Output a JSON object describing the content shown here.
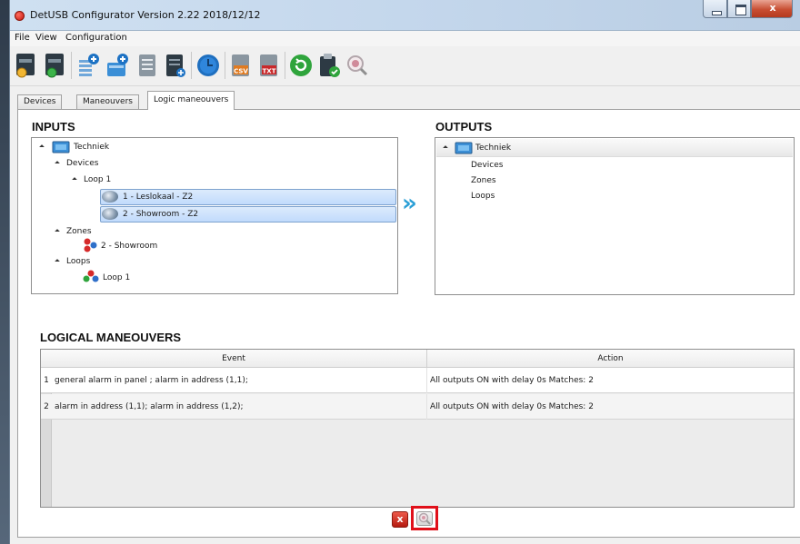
{
  "window": {
    "title": "DetUSB Configurator Version 2.22 2018/12/12",
    "close_glyph": "x"
  },
  "menu": {
    "items": [
      "File",
      "View",
      "Configuration"
    ]
  },
  "toolbar": {
    "icons": [
      "open-config-icon",
      "save-config-icon",
      "add-device-list-icon",
      "add-device-upload-icon",
      "document-icon",
      "document-add-icon",
      "clock-icon",
      "export-csv-icon",
      "export-txt-icon",
      "refresh-icon",
      "clipboard-check-icon",
      "search-icon"
    ],
    "csv_label": "CSV",
    "txt_label": "TXT"
  },
  "tabs": {
    "items": [
      "Devices",
      "Maneouvers",
      "Logic maneouvers"
    ],
    "active": "Logic maneouvers"
  },
  "inputs": {
    "heading": "INPUTS",
    "root": "Techniek",
    "devices": "Devices",
    "loop1": "Loop 1",
    "device1": "1 - Leslokaal - Z2",
    "device2": "2 - Showroom - Z2",
    "zones": "Zones",
    "zone2": "2 - Showroom",
    "loops": "Loops",
    "loop_item": "Loop 1"
  },
  "transfer": {
    "glyph": "»"
  },
  "outputs": {
    "heading": "OUTPUTS",
    "root": "Techniek",
    "devices": "Devices",
    "zones": "Zones",
    "loops": "Loops"
  },
  "logical": {
    "heading": "LOGICAL MANEOUVERS",
    "columns": {
      "event": "Event",
      "action": "Action"
    },
    "rows": [
      {
        "num": "1",
        "event": "general alarm in panel ; alarm  in address (1,1);",
        "action": "All outputs ON with delay 0s Matches: 2"
      },
      {
        "num": "2",
        "event": "alarm  in address (1,1); alarm  in address (1,2);",
        "action": "All outputs ON with delay 0s Matches: 2"
      }
    ]
  },
  "footer": {
    "delete_glyph": "x"
  },
  "colors": {
    "highlight": "#e0101a",
    "selection": "#c1dbfc",
    "transfer_arrow": "#2a9fd6"
  }
}
